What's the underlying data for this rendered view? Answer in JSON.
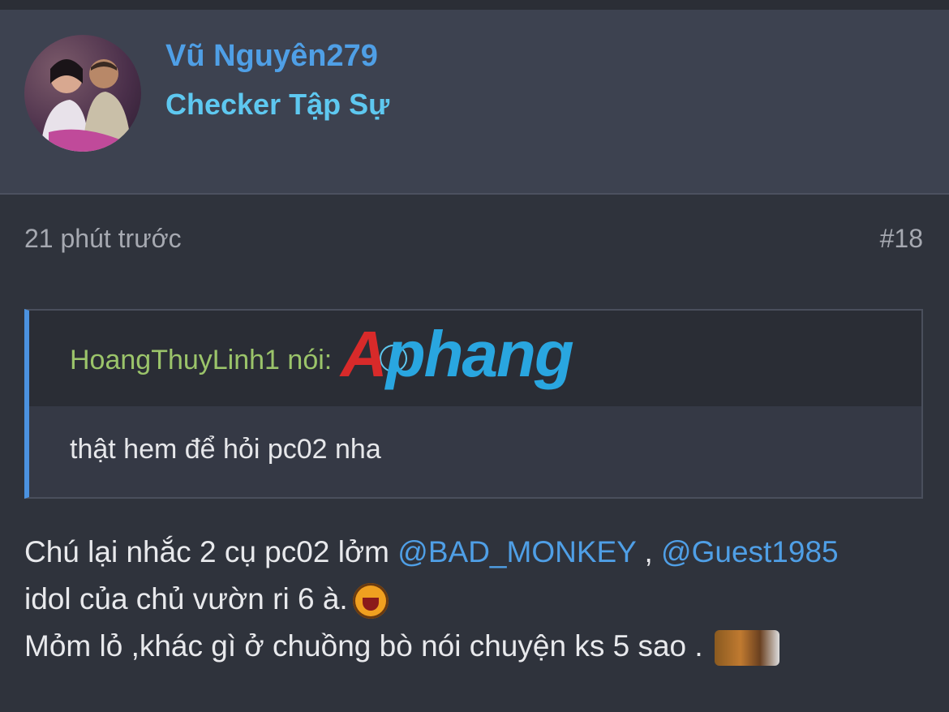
{
  "user": {
    "name": "Vũ Nguyên279",
    "title": "Checker Tập Sự"
  },
  "post": {
    "time": "21 phút trước",
    "number": "#18"
  },
  "quote": {
    "author": "HoangThuyLinh1 nói:",
    "arrow_icon": "arrow-up-circle-icon",
    "text": "thật hem để hỏi pc02 nha"
  },
  "watermark": {
    "letter": "A",
    "rest": "phang"
  },
  "message": {
    "line1_prefix": "Chú lại nhắc 2 cụ pc02 lởm ",
    "mention1": "@BAD_MONKEY",
    "separator": " , ",
    "mention2": "@Guest1985",
    "line2": "idol của chủ vườn ri 6 à.",
    "line3": "Mỏm lỏ ,khác gì ở chuồng bò nói chuyện ks 5 sao ."
  },
  "colors": {
    "username": "#4f9fe6",
    "usertitle": "#5ec8f0",
    "quote_author": "#9bc46a",
    "quote_border": "#4b92e0"
  }
}
